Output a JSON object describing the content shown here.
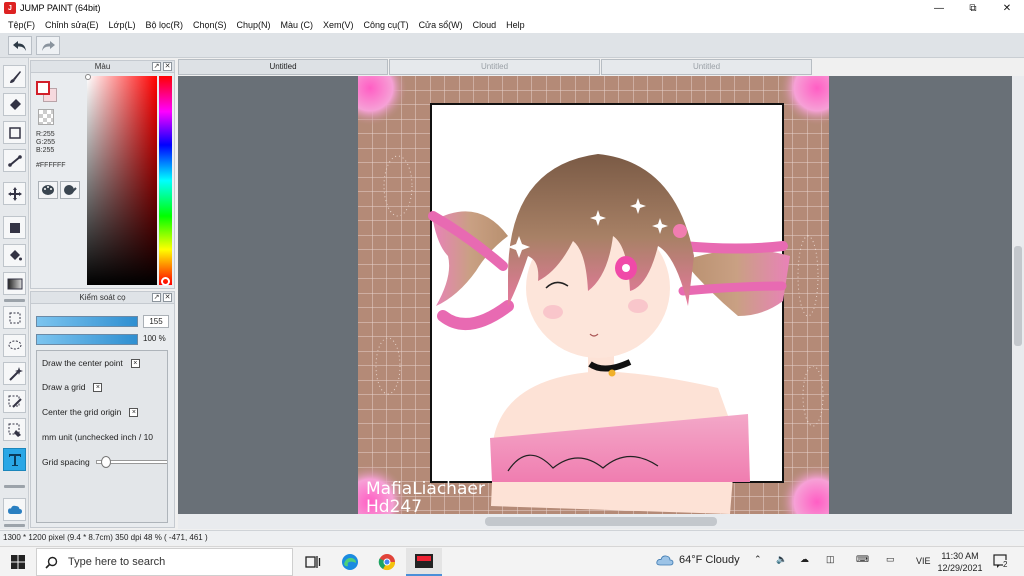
{
  "window": {
    "title": "JUMP PAINT (64bit)",
    "app_icon_text": "J"
  },
  "menu": [
    "Tệp(F)",
    "Chỉnh sửa(E)",
    "Lớp(L)",
    "Bộ lọc(R)",
    "Chọn(S)",
    "Chụp(N)",
    "Màu (C)",
    "Xem(V)",
    "Công cụ(T)",
    "Cửa sổ(W)",
    "Cloud",
    "Help"
  ],
  "color_panel": {
    "title": "Màu",
    "r": "R:255",
    "g": "G:255",
    "b": "B:255",
    "hex": "#FFFFFF",
    "foreground": "#FFFFFF",
    "background_swatch": "#F6D9DE"
  },
  "brush_panel": {
    "title": "Kiểm soát cọ",
    "size_value": "155",
    "opacity_value": "100 %",
    "options": {
      "draw_center": "Draw the center point",
      "draw_grid": "Draw a grid",
      "center_grid": "Center the grid origin",
      "mm_unit": "mm unit (unchecked inch / 10",
      "grid_spacing": "Grid spacing"
    },
    "checkbox_mark": "×"
  },
  "tabs": [
    {
      "label": "Untitled",
      "active": true
    },
    {
      "label": "Untitled",
      "active": false
    },
    {
      "label": "Untitled",
      "active": false
    }
  ],
  "artwork": {
    "signature_line1": "MafiaLiachaer",
    "signature_line2": "Hd247",
    "frame_color": "#B48A77",
    "accent_color": "#E86AB2"
  },
  "status": {
    "size": "1300 * 1200 pixel",
    "physical": "(9.4 * 8.7cm)",
    "dpi": "350 dpi",
    "zoom": "48 %",
    "cursor": "( -471, 461 )"
  },
  "taskbar": {
    "search_placeholder": "Type here to search",
    "weather": "64°F  Cloudy",
    "language": "VIE",
    "time": "11:30 AM",
    "date": "12/29/2021",
    "notification_count": "2"
  }
}
